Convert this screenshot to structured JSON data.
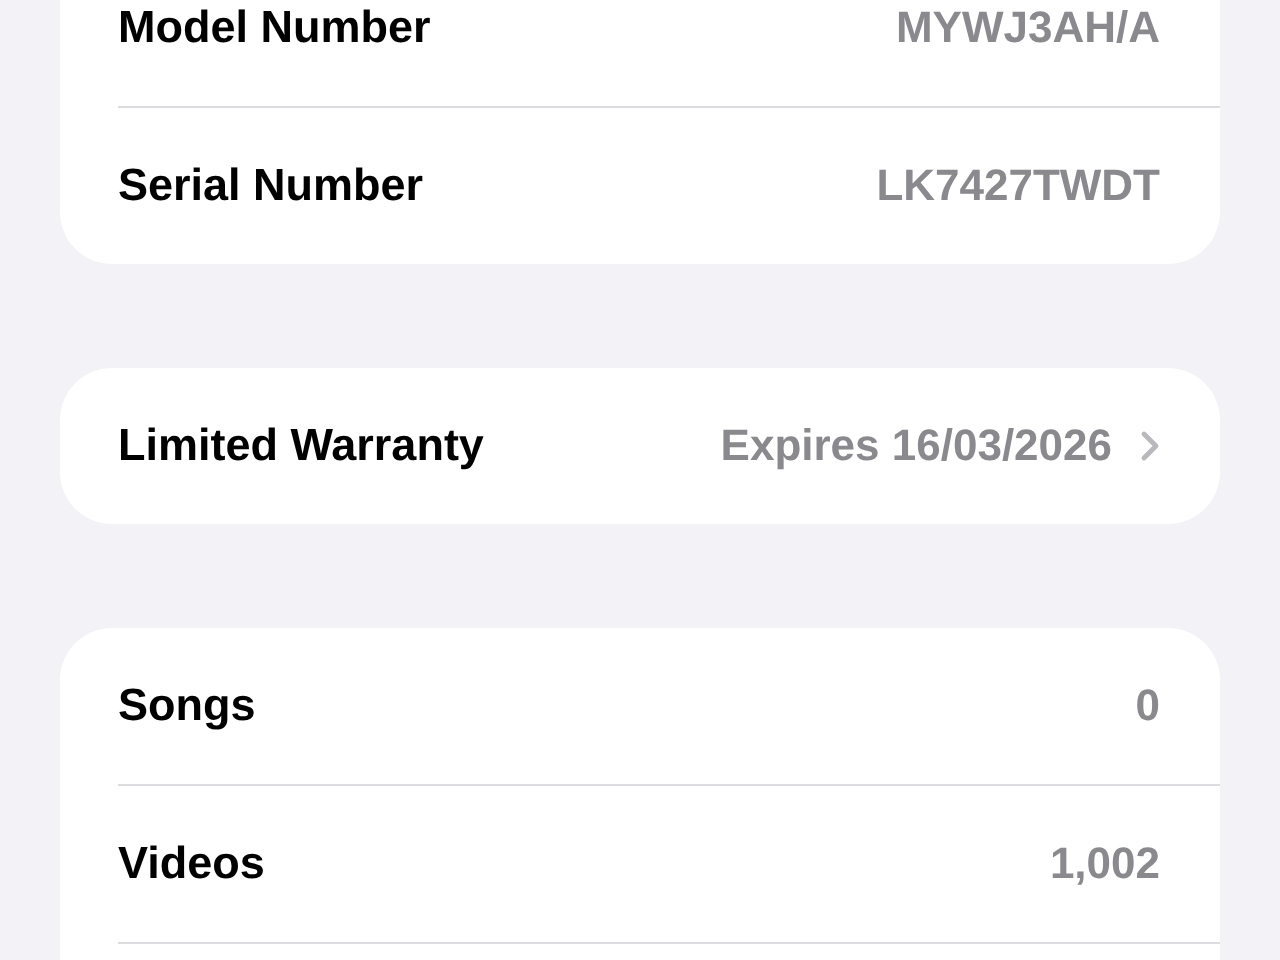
{
  "sections": [
    {
      "rows": [
        {
          "label": "Model Number",
          "value": "MYWJ3AH/A",
          "chevron": false
        },
        {
          "label": "Serial Number",
          "value": "LK7427TWDT",
          "chevron": false
        }
      ],
      "continues": false
    },
    {
      "rows": [
        {
          "label": "Limited Warranty",
          "value": "Expires 16/03/2026",
          "chevron": true
        }
      ],
      "continues": false
    },
    {
      "rows": [
        {
          "label": "Songs",
          "value": "0",
          "chevron": false
        },
        {
          "label": "Videos",
          "value": "1,002",
          "chevron": false
        }
      ],
      "continues": true
    }
  ]
}
